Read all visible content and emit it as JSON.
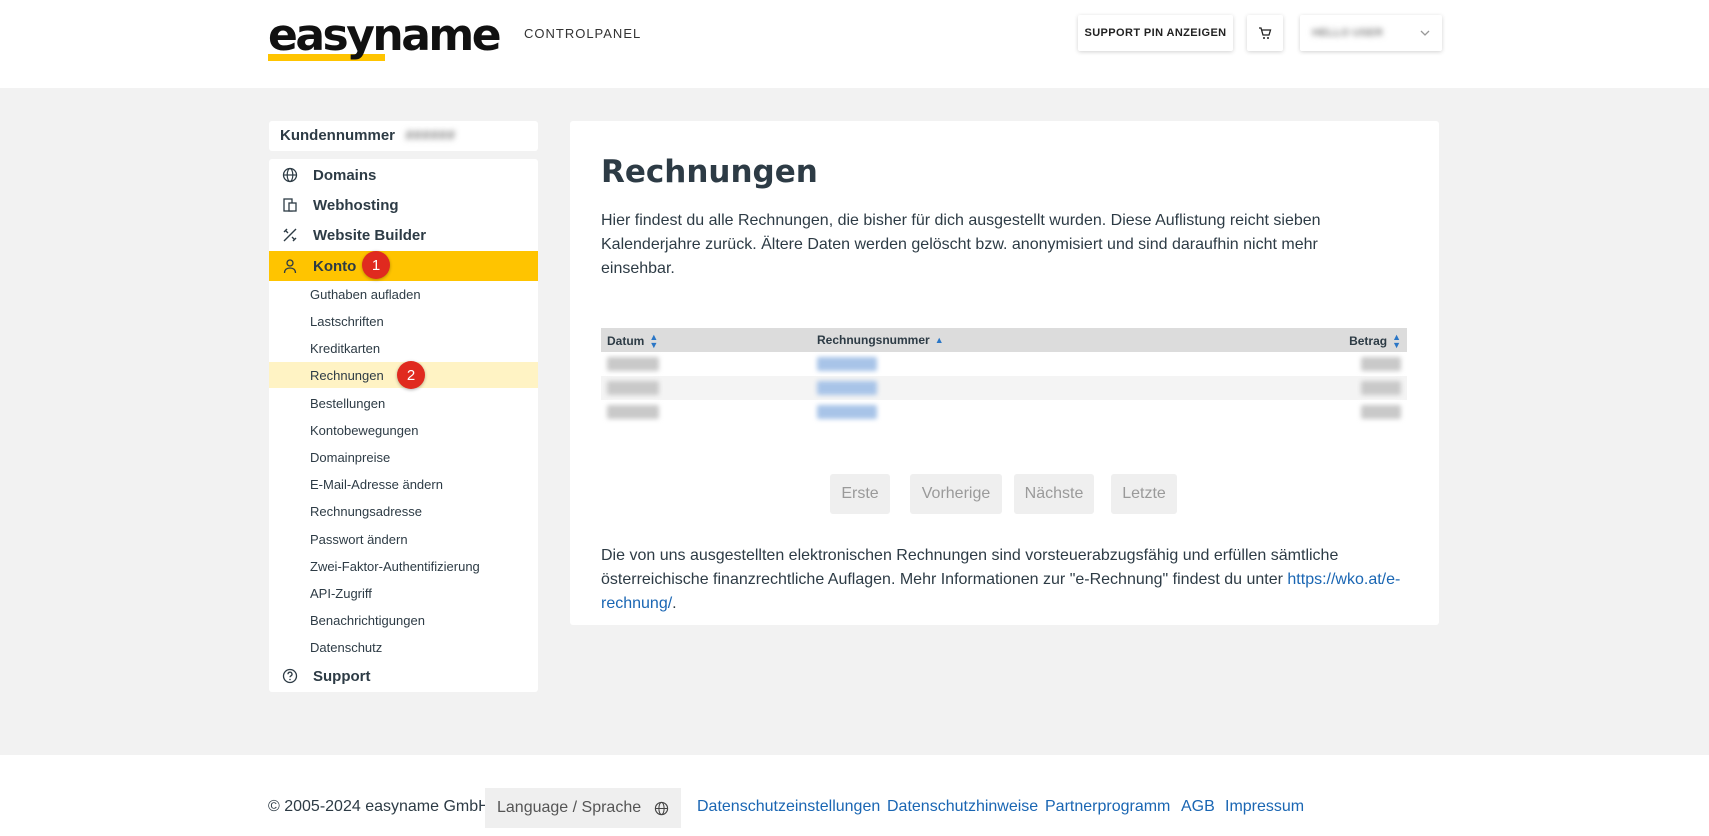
{
  "header": {
    "logo_text": "easyname",
    "subtitle": "CONTROLPANEL",
    "support_pin_label": "SUPPORT PIN ANZEIGEN",
    "user_name": "HELLO USER"
  },
  "sidebar": {
    "customer_label": "Kundennummer",
    "customer_number": "######",
    "main_items": [
      {
        "label": "Domains",
        "icon": "globe-icon"
      },
      {
        "label": "Webhosting",
        "icon": "hosting-icon"
      },
      {
        "label": "Website Builder",
        "icon": "builder-icon"
      },
      {
        "label": "Konto",
        "icon": "user-icon",
        "active": true
      }
    ],
    "sub_items": [
      "Guthaben aufladen",
      "Lastschriften",
      "Kreditkarten",
      "Rechnungen",
      "Bestellungen",
      "Kontobewegungen",
      "Domainpreise",
      "E-Mail-Adresse ändern",
      "Rechnungsadresse",
      "Passwort ändern",
      "Zwei-Faktor-Authentifizierung",
      "API-Zugriff",
      "Benachrichtigungen",
      "Datenschutz"
    ],
    "support_label": "Support",
    "badges": [
      "1",
      "2"
    ]
  },
  "main": {
    "title": "Rechnungen",
    "intro": "Hier findest du alle Rechnungen, die bisher für dich ausgestellt wurden. Diese Auflistung reicht sieben Kalenderjahre zurück. Ältere Daten werden gelöscht bzw. anonymisiert und sind daraufhin nicht mehr einsehbar.",
    "table": {
      "columns": [
        "Datum",
        "Rechnungsnummer",
        "Betrag"
      ]
    },
    "pager": {
      "first": "Erste",
      "prev": "Vorherige",
      "next": "Nächste",
      "last": "Letzte"
    },
    "note_text": "Die von uns ausgestellten elektronischen Rechnungen sind vorsteuerabzugsfähig und erfüllen sämtliche österreichische finanzrechtliche Auflagen. Mehr Informationen zur \"e-Rechnung\" findest du unter ",
    "note_link": "https://wko.at/e-rechnung/",
    "note_end": "."
  },
  "footer": {
    "copyright": "© 2005-2024 easyname GmbH",
    "language": "Language / Sprache",
    "links": [
      "Datenschutzeinstellungen",
      "Datenschutzhinweise",
      "Partnerprogramm",
      "AGB",
      "Impressum"
    ]
  },
  "colors": {
    "accent": "#ffc400",
    "active_sub": "#fff3c4",
    "badge": "#e02a1f",
    "link": "#1a66b3"
  }
}
